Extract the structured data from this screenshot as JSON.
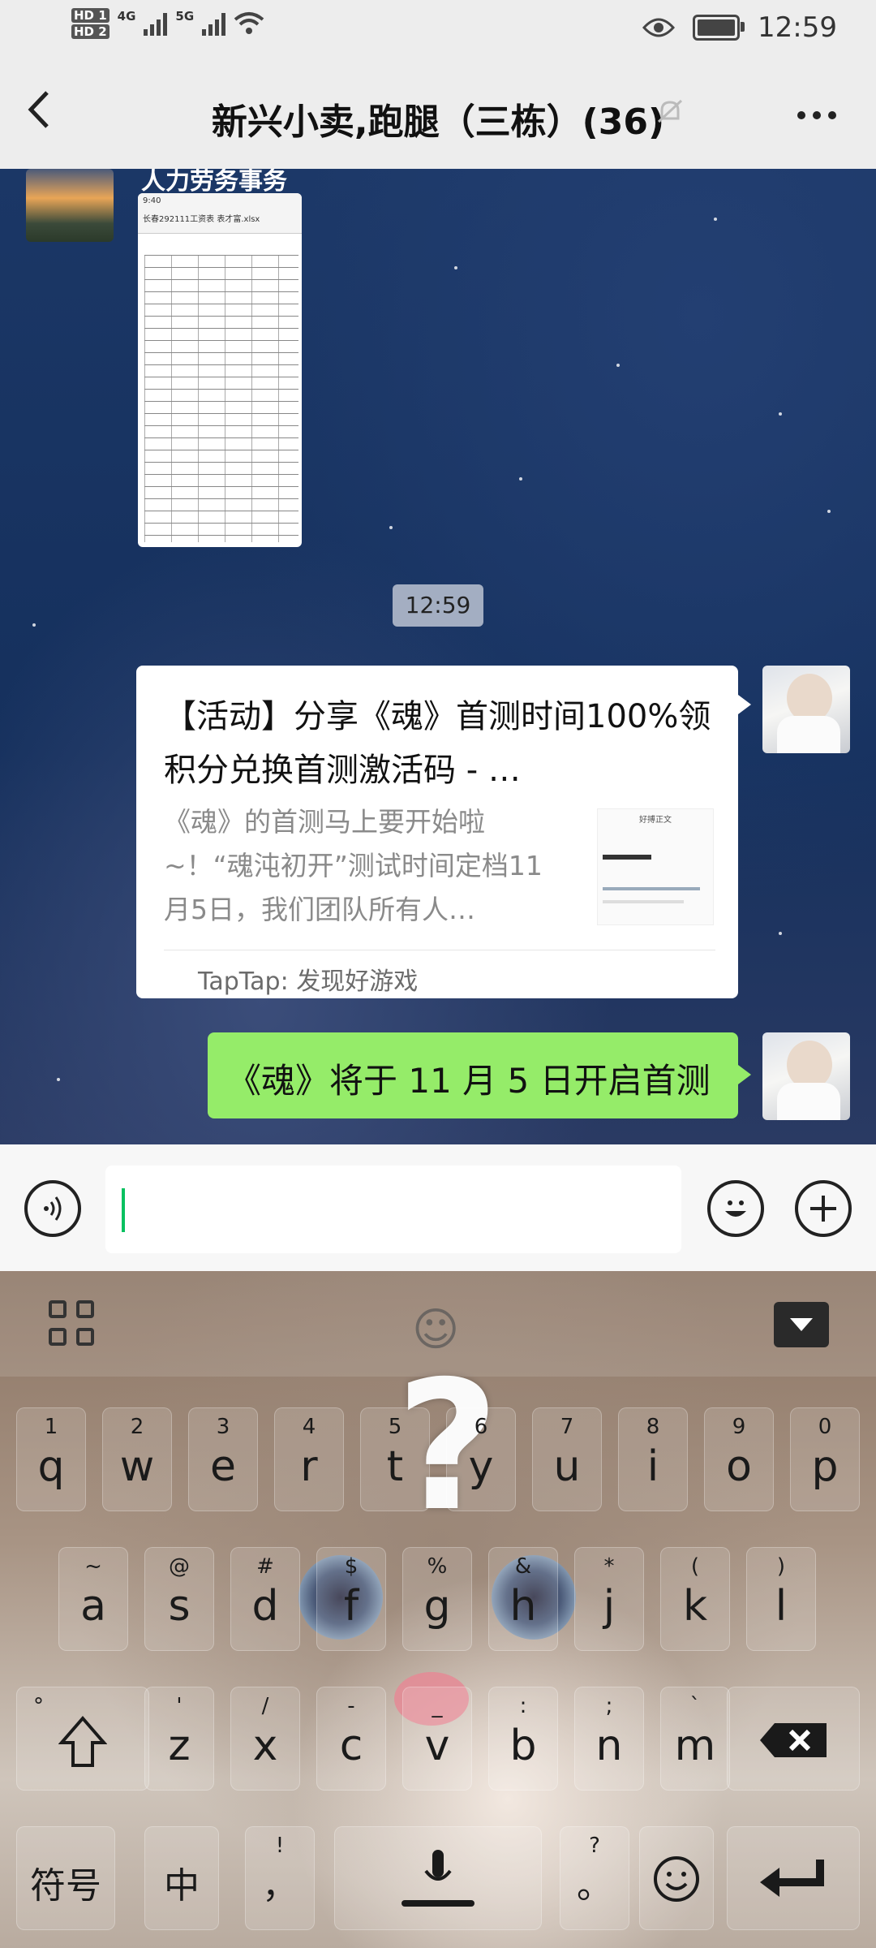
{
  "status": {
    "hd_badges": [
      "HD 1",
      "HD 2"
    ],
    "network": [
      "4G",
      "5G"
    ],
    "time": "12:59"
  },
  "titlebar": {
    "back_icon": "chevron-left-icon",
    "title": "新兴小卖,跑腿（三栋）(36)",
    "mute_icon": "bell-muted-icon",
    "more_icon": "more-dots-icon"
  },
  "chat": {
    "msg1": {
      "sender": "人力劳务事务",
      "image_header_time": "9:40",
      "image_header_title": "长春292111工资表 表才富.xlsx"
    },
    "timestamp": "12:59",
    "share_card": {
      "title": "【活动】分享《魂》首测时间100%领积分兑换首测激活码 - …",
      "description": "《魂》的首测马上要开始啦~！“魂沌初开”测试时间定档11月5日，我们团队所有人…",
      "thumb_title": "好搏正文",
      "source": "TapTap: 发现好游戏"
    },
    "text_message": "《魂》将于 11 月 5 日开启首测"
  },
  "inputbar": {
    "voice_icon": "voice-icon",
    "emoji_icon": "emoji-icon",
    "plus_icon": "plus-icon",
    "input_value": ""
  },
  "keyboard": {
    "row1": [
      {
        "sub": "1",
        "main": "q"
      },
      {
        "sub": "2",
        "main": "w"
      },
      {
        "sub": "3",
        "main": "e"
      },
      {
        "sub": "4",
        "main": "r"
      },
      {
        "sub": "5",
        "main": "t"
      },
      {
        "sub": "6",
        "main": "y"
      },
      {
        "sub": "7",
        "main": "u"
      },
      {
        "sub": "8",
        "main": "i"
      },
      {
        "sub": "9",
        "main": "o"
      },
      {
        "sub": "0",
        "main": "p"
      }
    ],
    "row2": [
      {
        "sub": "~",
        "main": "a"
      },
      {
        "sub": "@",
        "main": "s"
      },
      {
        "sub": "#",
        "main": "d"
      },
      {
        "sub": "$",
        "main": "f"
      },
      {
        "sub": "%",
        "main": "g"
      },
      {
        "sub": "&",
        "main": "h"
      },
      {
        "sub": "*",
        "main": "j"
      },
      {
        "sub": "(",
        "main": "k"
      },
      {
        "sub": ")",
        "main": "l"
      }
    ],
    "row3": [
      {
        "sub": "'",
        "main": "z"
      },
      {
        "sub": "/",
        "main": "x"
      },
      {
        "sub": "-",
        "main": "c"
      },
      {
        "sub": "_",
        "main": "v"
      },
      {
        "sub": ":",
        "main": "b"
      },
      {
        "sub": ";",
        "main": "n"
      },
      {
        "sub": "`",
        "main": "m"
      }
    ],
    "shift_sub": "°",
    "symbols_label": "符号",
    "lang_label": "中",
    "comma_sub": "!",
    "comma_main": "，",
    "period_sub": "?",
    "period_main": "。"
  }
}
